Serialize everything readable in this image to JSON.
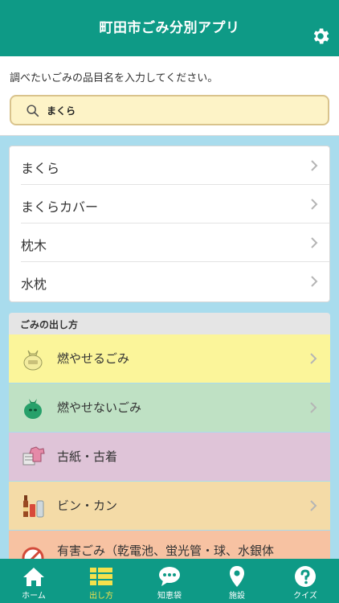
{
  "header": {
    "title": "町田市ごみ分別アプリ",
    "settings_icon": "gear-icon"
  },
  "prompt": "調べたいごみの品目名を入力してください。",
  "search": {
    "value": "まくら",
    "icon": "search-icon"
  },
  "results": [
    {
      "label": "まくら"
    },
    {
      "label": "まくらカバー"
    },
    {
      "label": "枕木"
    },
    {
      "label": "水枕"
    }
  ],
  "section": {
    "title": "ごみの出し方"
  },
  "categories": [
    {
      "label": "燃やせるごみ",
      "icon": "burnable-bag-icon",
      "color": "#fbf59a"
    },
    {
      "label": "燃やせないごみ",
      "icon": "nonburnable-bag-icon",
      "color": "#bfe1c4"
    },
    {
      "label": "古紙・古着",
      "icon": "paper-clothes-icon",
      "color": "#dfc4d8"
    },
    {
      "label": "ビン・カン",
      "icon": "bottle-can-icon",
      "color": "#f4dba7"
    },
    {
      "label": "有害ごみ（乾電池、蛍光管・球、水銀体",
      "icon": "hazardous-icon",
      "color": "#f7c2a2"
    }
  ],
  "tabs": [
    {
      "label": "ホーム",
      "icon": "home-icon",
      "active": false
    },
    {
      "label": "出し方",
      "icon": "list-grid-icon",
      "active": true
    },
    {
      "label": "知恵袋",
      "icon": "chat-bubble-icon",
      "active": false
    },
    {
      "label": "施設",
      "icon": "map-pin-icon",
      "active": false
    },
    {
      "label": "クイズ",
      "icon": "question-icon",
      "active": false
    }
  ],
  "colors": {
    "brand": "#0e9a86",
    "tab_active": "#f5e14b",
    "background": "#a9dced"
  }
}
